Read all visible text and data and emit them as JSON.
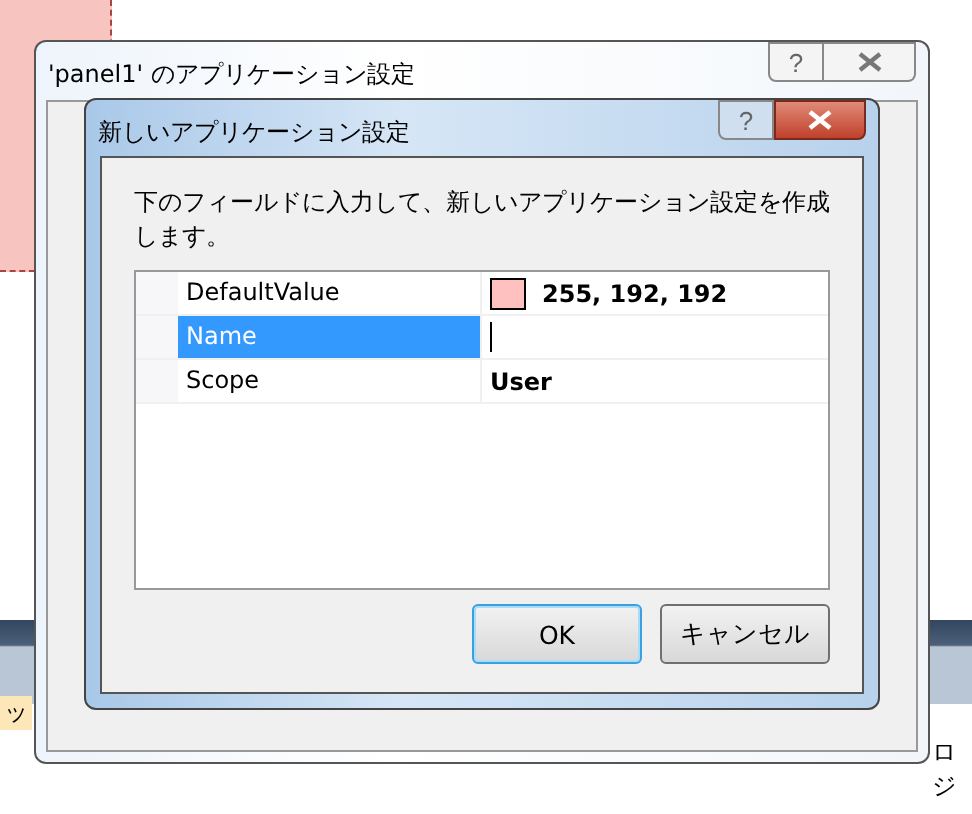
{
  "background": {
    "left_text": "ッ",
    "right_text": "ロジ"
  },
  "outer_window": {
    "title": "'panel1' のアプリケーション設定",
    "help": "?"
  },
  "dialog": {
    "title": "新しいアプリケーション設定",
    "help": "?",
    "instruction": "下のフィールドに入力して、新しいアプリケーション設定を作成します。",
    "properties": [
      {
        "name": "DefaultValue",
        "value": "255, 192, 192",
        "kind": "color",
        "color": "#ffc0c0",
        "selected": false
      },
      {
        "name": "Name",
        "kind": "text",
        "selected": true
      },
      {
        "name": "Scope",
        "value": "User",
        "kind": "text",
        "selected": false
      }
    ],
    "buttons": [
      {
        "label": "OK",
        "default": true
      },
      {
        "label": "キャンセル",
        "default": false
      }
    ]
  }
}
